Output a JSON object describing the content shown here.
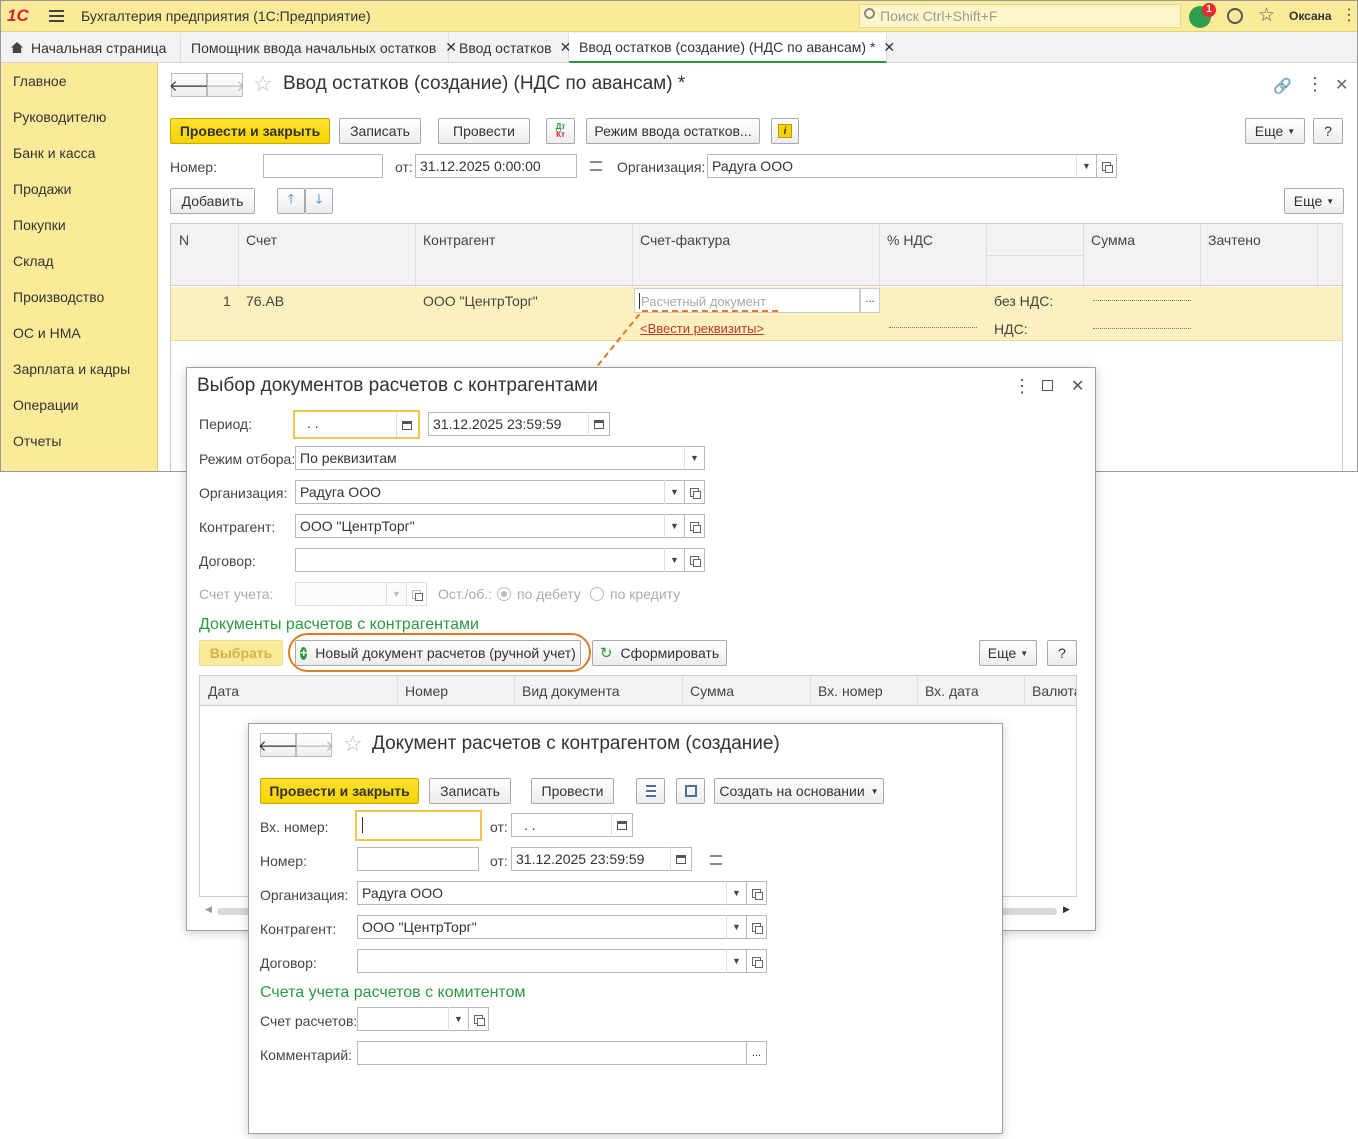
{
  "app": {
    "title": "Бухгалтерия предприятия  (1С:Предприятие)",
    "search_placeholder": "Поиск Ctrl+Shift+F",
    "notif_count": "1",
    "user": "Оксана",
    "logo": "1С"
  },
  "tabs": [
    "Начальная страница",
    "Помощник ввода начальных остатков",
    "Ввод остатков",
    "Ввод остатков (создание) (НДС по авансам) *"
  ],
  "sidebar": [
    "Главное",
    "Руководителю",
    "Банк и касса",
    "Продажи",
    "Покупки",
    "Склад",
    "Производство",
    "ОС и НМА",
    "Зарплата и кадры",
    "Операции",
    "Отчеты"
  ],
  "main": {
    "title": "Ввод остатков (создание) (НДС по авансам) *",
    "btn_post_close": "Провести и закрыть",
    "btn_save": "Записать",
    "btn_post": "Провести",
    "btn_mode": "Режим ввода остатков...",
    "btn_more": "Еще",
    "btn_help": "?",
    "number_label": "Номер:",
    "date_label": "от:",
    "date_value": "31.12.2025  0:00:00",
    "org_label": "Организация:",
    "org_value": "Радуга ООО",
    "btn_add": "Добавить",
    "columns": [
      "N",
      "Счет",
      "Контрагент",
      "Счет-фактура",
      "% НДС",
      "Сумма",
      "Зачтено"
    ],
    "row": {
      "n": "1",
      "account": "76.АВ",
      "counterparty": "ООО \"ЦентрТорг\"",
      "invoice_placeholder": "Расчетный документ",
      "enter_link": "<Ввести реквизиты>",
      "no_vat": "без НДС:",
      "vat": "НДС:"
    }
  },
  "selection": {
    "title": "Выбор документов расчетов с контрагентами",
    "period_label": "Период:",
    "period_from": ". .",
    "period_to": "31.12.2025 23:59:59",
    "filter_label": "Режим отбора:",
    "filter_value": "По реквизитам",
    "org_label": "Организация:",
    "org_value": "Радуга ООО",
    "cp_label": "Контрагент:",
    "cp_value": "ООО \"ЦентрТорг\"",
    "contract_label": "Договор:",
    "acc_label": "Счет учета:",
    "bal_label": "Ост./об.:",
    "debit": "по дебету",
    "credit": "по кредиту",
    "section": "Документы расчетов с контрагентами",
    "btn_select": "Выбрать",
    "btn_new": "Новый документ расчетов (ручной учет)",
    "btn_generate": "Сформировать",
    "btn_more": "Еще",
    "btn_help": "?",
    "columns": [
      "Дата",
      "Номер",
      "Вид документа",
      "Сумма",
      "Вх. номер",
      "Вх. дата",
      "Валюта"
    ]
  },
  "doc": {
    "title": "Документ расчетов с контрагентом (создание)",
    "btn_post_close": "Провести и закрыть",
    "btn_save": "Записать",
    "btn_post": "Провести",
    "btn_create_basis": "Создать на основании",
    "in_number_label": "Вх. номер:",
    "in_date_label": "от:",
    "in_date_value": ". .",
    "number_label": "Номер:",
    "date_label": "от:",
    "date_value": "31.12.2025 23:59:59",
    "org_label": "Организация:",
    "org_value": "Радуга ООО",
    "cp_label": "Контрагент:",
    "cp_value": "ООО \"ЦентрТорг\"",
    "contract_label": "Договор:",
    "section": "Счета учета расчетов с комитентом",
    "acc_label": "Счет расчетов:",
    "comment_label": "Комментарий:"
  },
  "colors": {
    "accent": "#f5d300",
    "green": "#2a9a3e",
    "annotation": "#e07b22"
  }
}
